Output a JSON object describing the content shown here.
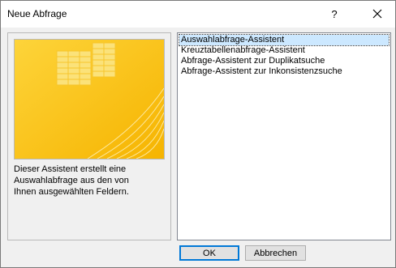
{
  "window": {
    "title": "Neue Abfrage"
  },
  "titlebar": {
    "help_label": "?"
  },
  "description": "Dieser Assistent erstellt eine\nAuswahlabfrage aus den von\nIhnen ausgewählten Feldern.",
  "wizards": [
    {
      "label": "Auswahlabfrage-Assistent",
      "selected": true
    },
    {
      "label": "Kreuztabellenabfrage-Assistent",
      "selected": false
    },
    {
      "label": "Abfrage-Assistent zur Duplikatsuche",
      "selected": false
    },
    {
      "label": "Abfrage-Assistent zur Inkonsistenzsuche",
      "selected": false
    }
  ],
  "buttons": {
    "ok": "OK",
    "cancel": "Abbrechen"
  },
  "colors": {
    "accent": "#0078d7",
    "selection": "#cce8ff",
    "preview_yellow": "#fcc31a"
  }
}
